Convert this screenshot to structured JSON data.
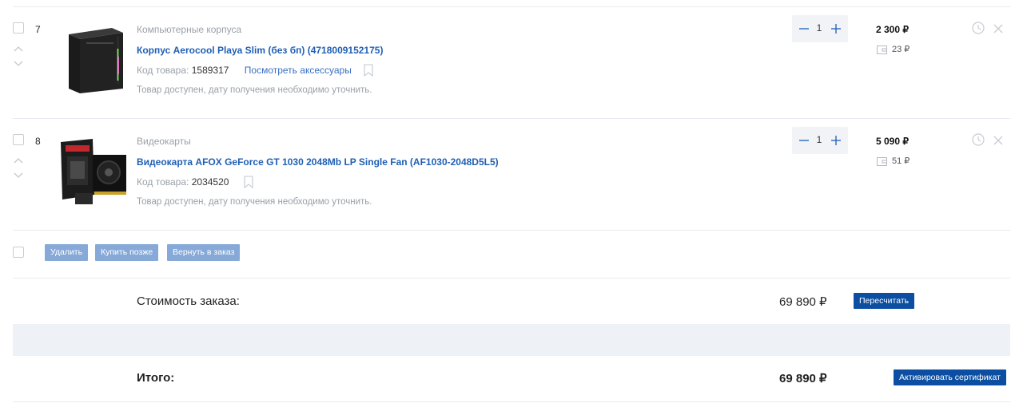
{
  "items": [
    {
      "index": "7",
      "category": "Компьютерные корпуса",
      "title": "Корпус Aerocool Playa Slim (без бп) (4718009152175)",
      "code_label": "Код товара:",
      "code": "1589317",
      "accessories_link": "Посмотреть аксессуары",
      "availability": "Товар доступен, дату получения необходимо уточнить.",
      "quantity": "1",
      "price": "2 300 ₽",
      "bonus": "23 ₽"
    },
    {
      "index": "8",
      "category": "Видеокарты",
      "title": "Видеокарта AFOX GeForce GT 1030 2048Mb LP Single Fan (AF1030-2048D5L5)",
      "code_label": "Код товара:",
      "code": "2034520",
      "availability": "Товар доступен, дату получения необходимо уточнить.",
      "quantity": "1",
      "price": "5 090 ₽",
      "bonus": "51 ₽"
    }
  ],
  "actions": {
    "delete": "Удалить",
    "buy_later": "Купить позже",
    "return_to_order": "Вернуть в заказ"
  },
  "summary": {
    "order_cost_label": "Стоимость заказа:",
    "order_cost_value": "69 890 ₽",
    "recalc_button": "Пересчитать",
    "total_label": "Итого:",
    "total_value": "69 890 ₽",
    "activate_certificate_button": "Активировать сертификат"
  },
  "icons": {
    "minus": "minus-icon",
    "plus": "plus-icon",
    "clock": "clock-icon",
    "close": "close-icon",
    "bookmark": "bookmark-icon",
    "wallet": "wallet-icon",
    "chevron_up": "chevron-up-icon",
    "chevron_down": "chevron-down-icon"
  },
  "colors": {
    "link": "#1f5fb4",
    "button_primary": "#0b4ea2",
    "button_light": "#86a9d8",
    "band": "#eef2f7"
  }
}
